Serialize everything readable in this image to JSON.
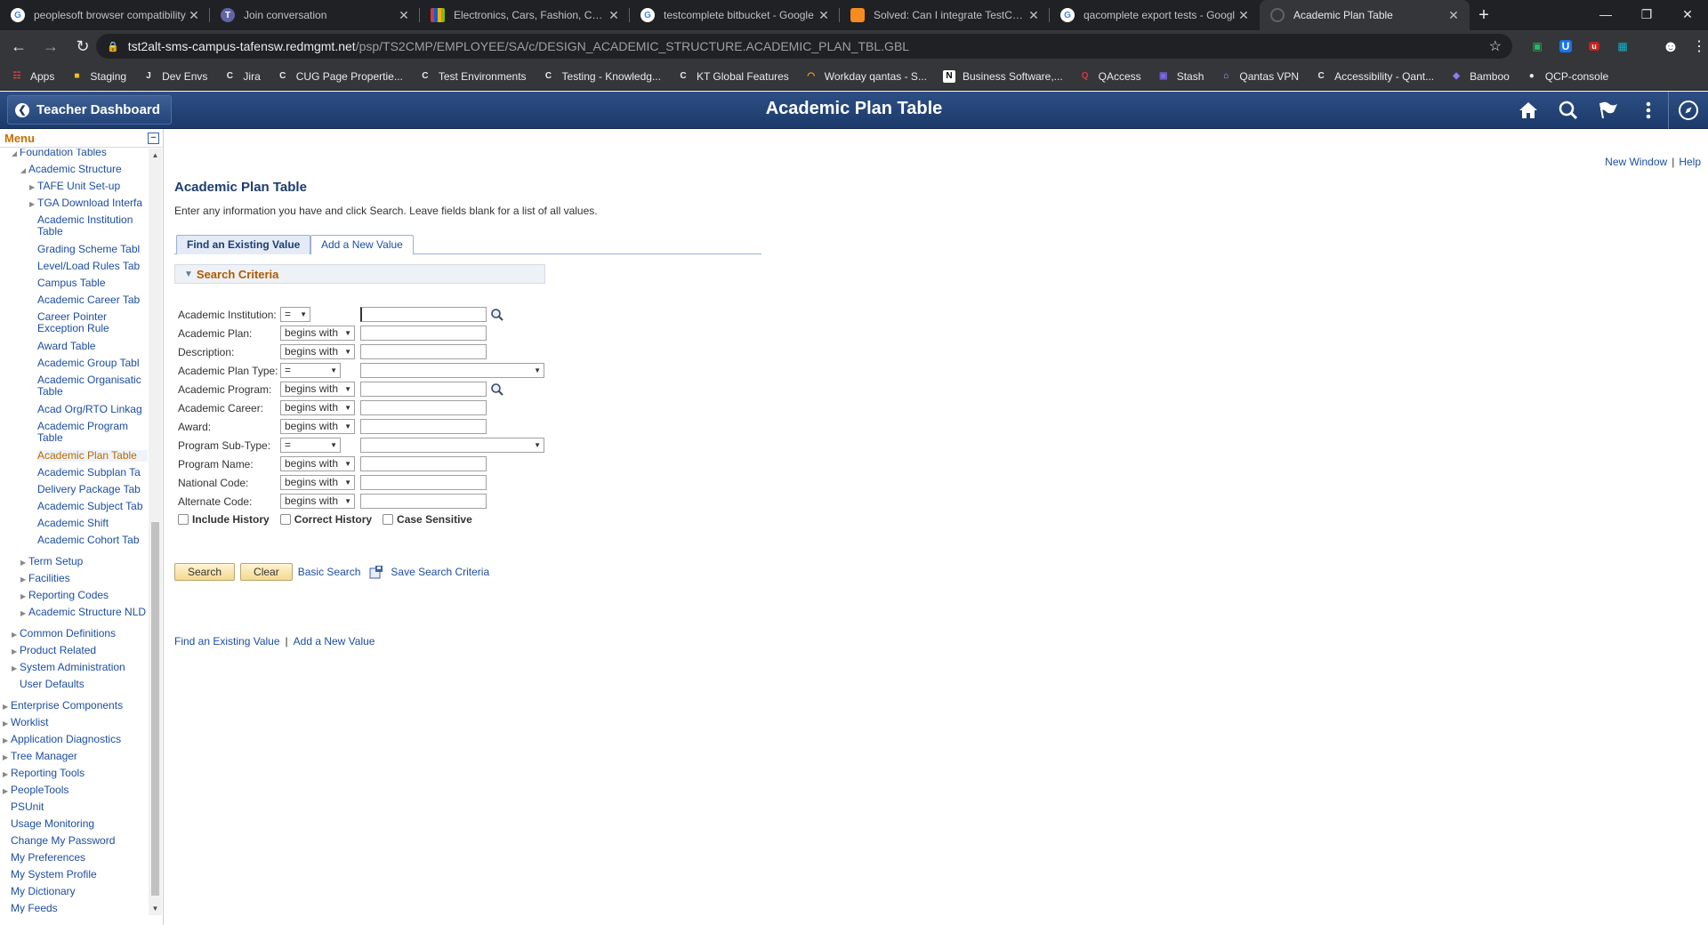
{
  "browser": {
    "tabs": [
      {
        "title": "peoplesoft browser compatibility",
        "icon": "google-icon"
      },
      {
        "title": "Join conversation",
        "icon": "teams-icon"
      },
      {
        "title": "Electronics, Cars, Fashion, Collect",
        "icon": "ebay-icon"
      },
      {
        "title": "testcomplete bitbucket - Google",
        "icon": "google-icon"
      },
      {
        "title": "Solved: Can I integrate TestComp",
        "icon": "smartbear-icon"
      },
      {
        "title": "qacomplete export tests - Googl",
        "icon": "google-icon"
      },
      {
        "title": "Academic Plan Table",
        "icon": "loading-icon"
      }
    ],
    "url_host": "tst2alt-sms-campus-tafensw.redmgmt.net",
    "url_path": "/psp/TS2CMP/EMPLOYEE/SA/c/DESIGN_ACADEMIC_STRUCTURE.ACADEMIC_PLAN_TBL.GBL",
    "bookmarks": [
      "Apps",
      "Staging",
      "Dev Envs",
      "Jira",
      "CUG Page Propertie...",
      "Test Environments",
      "Testing - Knowledg...",
      "KT Global Features",
      "Workday qantas - S...",
      "Business Software,...",
      "QAccess",
      "Stash",
      "Qantas VPN",
      "Accessibility - Qant...",
      "Bamboo",
      "QCP-console"
    ]
  },
  "header": {
    "back_label": "Teacher Dashboard",
    "title": "Academic Plan Table"
  },
  "menu": {
    "title": "Menu",
    "items": [
      {
        "label": "Foundation Tables",
        "level": 1,
        "tri": "open"
      },
      {
        "label": "Academic Structure",
        "level": 2,
        "tri": "open"
      },
      {
        "label": "TAFE Unit Set-up",
        "level": 3,
        "tri": "closed"
      },
      {
        "label": "TGA Download Interfa",
        "level": 3,
        "tri": "closed"
      },
      {
        "label": "Academic Institution",
        "label2": "Table",
        "level": 3
      },
      {
        "label": "Grading Scheme Tabl",
        "level": 3
      },
      {
        "label": "Level/Load Rules Tab",
        "level": 3
      },
      {
        "label": "Campus Table",
        "level": 3
      },
      {
        "label": "Academic Career Tab",
        "level": 3
      },
      {
        "label": "Career Pointer",
        "label2": "Exception Rule",
        "level": 3
      },
      {
        "label": "Award Table",
        "level": 3
      },
      {
        "label": "Academic Group Tabl",
        "level": 3
      },
      {
        "label": "Academic Organisatic",
        "label2": "Table",
        "level": 3
      },
      {
        "label": "Acad Org/RTO Linkag",
        "level": 3
      },
      {
        "label": "Academic Program",
        "label2": "Table",
        "level": 3
      },
      {
        "label": "Academic Plan Table",
        "level": 3,
        "current": true
      },
      {
        "label": "Academic Subplan Ta",
        "level": 3
      },
      {
        "label": "Delivery Package Tab",
        "level": 3
      },
      {
        "label": "Academic Subject Tab",
        "level": 3
      },
      {
        "label": "Academic Shift",
        "level": 3
      },
      {
        "label": "Academic Cohort Tab",
        "level": 3
      },
      {
        "label": "Term Setup",
        "level": 2,
        "tri": "closed"
      },
      {
        "label": "Facilities",
        "level": 2,
        "tri": "closed"
      },
      {
        "label": "Reporting Codes",
        "level": 2,
        "tri": "closed"
      },
      {
        "label": "Academic Structure NLD",
        "level": 2,
        "tri": "closed"
      },
      {
        "label": "Common Definitions",
        "level": 1,
        "tri": "closed"
      },
      {
        "label": "Product Related",
        "level": 1,
        "tri": "closed"
      },
      {
        "label": "System Administration",
        "level": 1,
        "tri": "closed"
      },
      {
        "label": "User Defaults",
        "level": 1
      },
      {
        "label": "Enterprise Components",
        "level": 0,
        "tri": "closed"
      },
      {
        "label": "Worklist",
        "level": 0,
        "tri": "closed"
      },
      {
        "label": "Application Diagnostics",
        "level": 0,
        "tri": "closed"
      },
      {
        "label": "Tree Manager",
        "level": 0,
        "tri": "closed"
      },
      {
        "label": "Reporting Tools",
        "level": 0,
        "tri": "closed"
      },
      {
        "label": "PeopleTools",
        "level": 0,
        "tri": "closed"
      },
      {
        "label": "PSUnit",
        "level": 0
      },
      {
        "label": "Usage Monitoring",
        "level": 0
      },
      {
        "label": "Change My Password",
        "level": 0
      },
      {
        "label": "My Preferences",
        "level": 0
      },
      {
        "label": "My System Profile",
        "level": 0
      },
      {
        "label": "My Dictionary",
        "level": 0
      },
      {
        "label": "My Feeds",
        "level": 0
      }
    ]
  },
  "page": {
    "new_window": "New Window",
    "help": "Help",
    "title": "Academic Plan Table",
    "instructions": "Enter any information you have and click Search. Leave fields blank for a list of all values.",
    "tab_find": "Find an Existing Value",
    "tab_add": "Add a New Value",
    "search_criteria": "Search Criteria",
    "fields": [
      {
        "label": "Academic Institution:",
        "operator": "=",
        "input": "text",
        "lookup": true
      },
      {
        "label": "Academic Plan:",
        "operator": "begins with",
        "input": "text"
      },
      {
        "label": "Description:",
        "operator": "begins with",
        "input": "text"
      },
      {
        "label": "Academic Plan Type:",
        "operator": "=",
        "input": "select"
      },
      {
        "label": "Academic Program:",
        "operator": "begins with",
        "input": "text",
        "lookup": true
      },
      {
        "label": "Academic Career:",
        "operator": "begins with",
        "input": "text"
      },
      {
        "label": "Award:",
        "operator": "begins with",
        "input": "text"
      },
      {
        "label": "Program Sub-Type:",
        "operator": "=",
        "input": "select"
      },
      {
        "label": "Program Name:",
        "operator": "begins with",
        "input": "text"
      },
      {
        "label": "National Code:",
        "operator": "begins with",
        "input": "text"
      },
      {
        "label": "Alternate Code:",
        "operator": "begins with",
        "input": "text"
      }
    ],
    "include_history": "Include History",
    "correct_history": "Correct History",
    "case_sensitive": "Case Sensitive",
    "search_btn": "Search",
    "clear_btn": "Clear",
    "basic_search": "Basic Search",
    "save_search": "Save Search Criteria",
    "bottom_find": "Find an Existing Value",
    "bottom_add": "Add a New Value"
  },
  "colors": {
    "header_blue": "#1c3a6b",
    "link_blue": "#1c4ea1",
    "section_orange": "#b05a00"
  }
}
